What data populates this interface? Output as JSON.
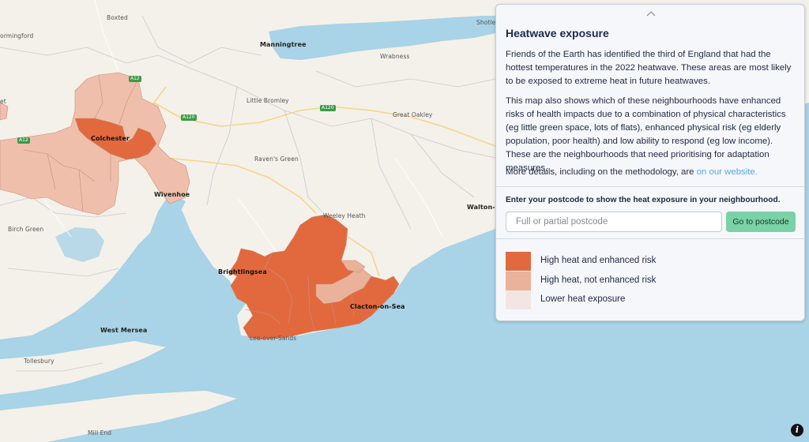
{
  "panel": {
    "title": "Heatwave exposure",
    "para1": "Friends of the Earth has identified the third of England that had the hottest temperatures in the 2022 heatwave. These areas are most likely to be exposed to extreme heat in future heatwaves.",
    "para2": "This map also shows which of these neighbourhoods have enhanced risks of health impacts due to a combination of physical characteristics (eg little green space, lots of flats), enhanced physical risk (eg elderly population, poor health) and low ability to respond (eg low income). These are the neighbourhoods that need prioritising for adaptation measures.",
    "para3_text": "More details, including on the methodology, are ",
    "para3_link": "on our website.",
    "postcode_prompt": "Enter your postcode to show the heat exposure in your neighbourhood.",
    "postcode_placeholder": "Full or partial postcode",
    "go_label": "Go to postcode"
  },
  "legend": [
    {
      "label": "High heat and enhanced risk",
      "color": "#e2693e"
    },
    {
      "label": "High heat, not enhanced risk",
      "color": "#eab29b"
    },
    {
      "label": "Lower heat exposure",
      "color": "#f3e6e2"
    }
  ],
  "map": {
    "places": {
      "boxted": "Boxted",
      "formingford": "ormingford",
      "manningtree": "Manningtree",
      "shotley": "Shotley",
      "wrabness": "Wrabness",
      "little_bromley": "Little Bromley",
      "great_oakley": "Great Oakley",
      "colchester": "Colchester",
      "ravens_green": "Raven's Green",
      "wivenhoe": "Wivenhoe",
      "weeley_heath": "Weeley Heath",
      "walton": "Walton-on-",
      "birch_green": "Birch Green",
      "brightlingsea": "Brightlingsea",
      "clacton": "Clacton-on-Sea",
      "west_mersea": "West Mersea",
      "lee_over_sands": "Lee-over-Sands",
      "tollesbury": "Tollesbury",
      "mill_end": "Mill End",
      "et": "et"
    },
    "roads": {
      "a12_north": "A12",
      "a120_west": "A120",
      "a120_east": "A120",
      "a12_west": "A12"
    }
  }
}
